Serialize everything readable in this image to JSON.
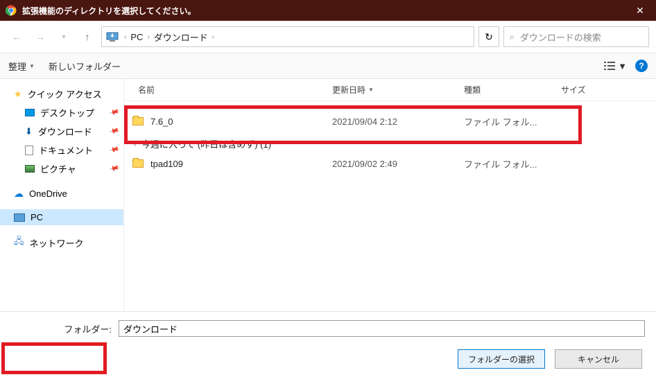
{
  "titlebar": {
    "title": "拡張機能のディレクトリを選択してください。"
  },
  "breadcrumb": {
    "root": "PC",
    "folder": "ダウンロード"
  },
  "search": {
    "placeholder": "ダウンロードの検索"
  },
  "toolbar": {
    "organize": "整理",
    "new_folder": "新しいフォルダー"
  },
  "sidebar": {
    "quick_access": "クイック アクセス",
    "desktop": "デスクトップ",
    "downloads": "ダウンロード",
    "documents": "ドキュメント",
    "pictures": "ピクチャ",
    "onedrive": "OneDrive",
    "pc": "PC",
    "network": "ネットワーク"
  },
  "columns": {
    "name": "名前",
    "date": "更新日時",
    "type": "種類",
    "size": "サイズ"
  },
  "groups": {
    "g1": {
      "header": "今週に入って (昨日は含めず) (1)"
    }
  },
  "rows": {
    "r1": {
      "name": "7.6_0",
      "date": "2021/09/04 2:12",
      "type": "ファイル フォル..."
    },
    "r2": {
      "name": "tpad109",
      "date": "2021/09/02 2:49",
      "type": "ファイル フォル..."
    }
  },
  "footer": {
    "folder_label": "フォルダー:",
    "folder_value": "ダウンロード",
    "select": "フォルダーの選択",
    "cancel": "キャンセル"
  }
}
